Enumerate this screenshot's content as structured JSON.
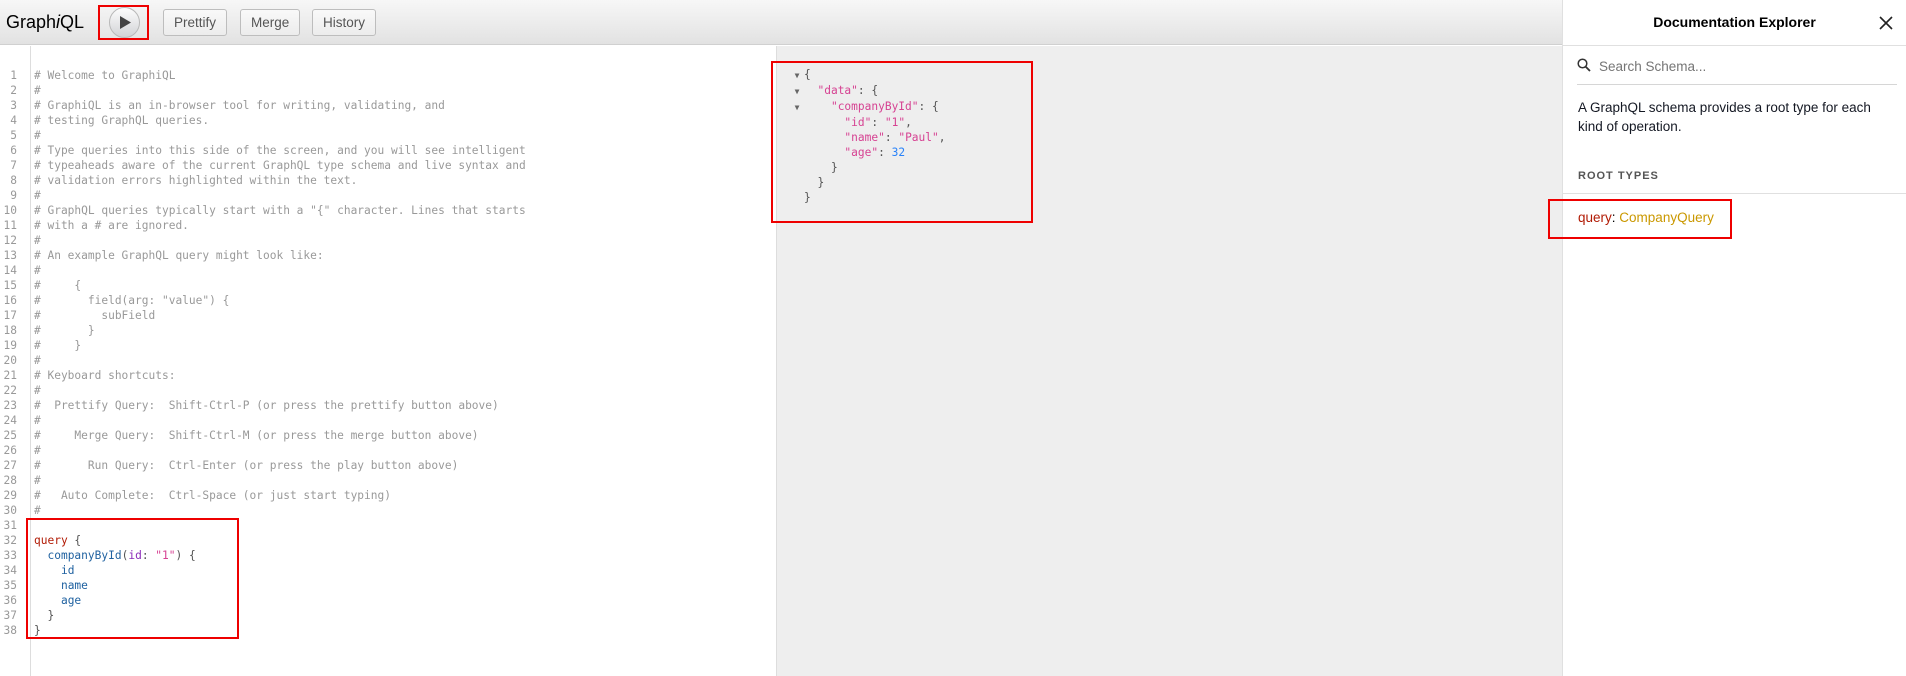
{
  "toolbar": {
    "logo_prefix": "Graph",
    "logo_italic": "i",
    "logo_suffix": "QL",
    "run_icon": "play-icon",
    "prettify_label": "Prettify",
    "merge_label": "Merge",
    "history_label": "History"
  },
  "editor": {
    "comment_lines": [
      "# Welcome to GraphiQL",
      "#",
      "# GraphiQL is an in-browser tool for writing, validating, and",
      "# testing GraphQL queries.",
      "#",
      "# Type queries into this side of the screen, and you will see intelligent",
      "# typeaheads aware of the current GraphQL type schema and live syntax and",
      "# validation errors highlighted within the text.",
      "#",
      "# GraphQL queries typically start with a \"{\" character. Lines that starts",
      "# with a # are ignored.",
      "#",
      "# An example GraphQL query might look like:",
      "#",
      "#     {",
      "#       field(arg: \"value\") {",
      "#         subField",
      "#       }",
      "#     }",
      "#",
      "# Keyboard shortcuts:",
      "#",
      "#  Prettify Query:  Shift-Ctrl-P (or press the prettify button above)",
      "#",
      "#     Merge Query:  Shift-Ctrl-M (or press the merge button above)",
      "#",
      "#       Run Query:  Ctrl-Enter (or press the play button above)",
      "#",
      "#   Auto Complete:  Ctrl-Space (or just start typing)",
      "#",
      ""
    ],
    "query": {
      "keyword": "query",
      "field": "companyById",
      "arg_name": "id",
      "arg_value": "\"1\"",
      "subfields": [
        "id",
        "name",
        "age"
      ]
    }
  },
  "result": {
    "data_key": "\"data\"",
    "company_key": "\"companyById\"",
    "fields": [
      {
        "key": "\"id\"",
        "value": "\"1\"",
        "kind": "str",
        "comma": ","
      },
      {
        "key": "\"name\"",
        "value": "\"Paul\"",
        "kind": "str",
        "comma": ","
      },
      {
        "key": "\"age\"",
        "value": "32",
        "kind": "num",
        "comma": ""
      }
    ]
  },
  "docs": {
    "title": "Documentation Explorer",
    "close_icon": "close-icon",
    "search_placeholder": "Search Schema...",
    "description": "A GraphQL schema provides a root type for each kind of operation.",
    "root_types_title": "ROOT TYPES",
    "root_field": "query",
    "root_type": "CompanyQuery"
  }
}
